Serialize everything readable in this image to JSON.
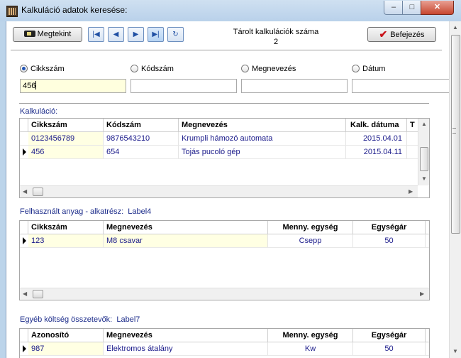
{
  "window": {
    "title": "Kalkuláció adatok keresése:",
    "minimize_glyph": "–",
    "maximize_glyph": "□",
    "close_glyph": "✕"
  },
  "toolbar": {
    "view_button": "Megtekint",
    "view_icon": "keyboard-icon",
    "nav_first": "|◀",
    "nav_prev": "◀",
    "nav_next": "▶",
    "nav_last": "▶|",
    "nav_refresh": "↻",
    "counter_label": "Tárolt kalkulációk száma",
    "counter_value": "2",
    "finish_button": "Befejezés",
    "finish_icon_glyph": "✔"
  },
  "search": {
    "options": [
      {
        "label": "Cikkszám",
        "selected": true
      },
      {
        "label": "Kódszám",
        "selected": false
      },
      {
        "label": "Megnevezés",
        "selected": false
      },
      {
        "label": "Dátum",
        "selected": false
      }
    ],
    "fields": [
      "456",
      "",
      "",
      ""
    ]
  },
  "calc": {
    "label": "Kalkuláció:",
    "headers": [
      "Cikkszám",
      "Kódszám",
      "Megnevezés",
      "Kalk. dátuma",
      "T"
    ],
    "rows": [
      {
        "cikkszam": "0123456789",
        "kodszam": "9876543210",
        "megnevezes": "Krumpli hámozó automata",
        "datum": "2015.04.01"
      },
      {
        "cikkszam": "456",
        "kodszam": "654",
        "megnevezes": "Tojás pucoló gép",
        "datum": "2015.04.11"
      }
    ]
  },
  "material": {
    "label": "Felhasznált anyag - alkatrész:",
    "sub_label": "Label4",
    "headers": [
      "Cikkszám",
      "Megnevezés",
      "Menny. egység",
      "Egységár"
    ],
    "rows": [
      {
        "cikkszam": "123",
        "megnevezes": "M8 csavar",
        "egyseg": "Csepp",
        "ar": "50"
      }
    ]
  },
  "costs": {
    "label": "Egyéb költség összetevők:",
    "sub_label": "Label7",
    "headers": [
      "Azonosító",
      "Megnevezés",
      "Menny. egység",
      "Egységár"
    ],
    "rows": [
      {
        "azonosito": "987",
        "megnevezes": "Elektromos átalány",
        "egyseg": "Kw",
        "ar": "50"
      }
    ]
  },
  "scroll": {
    "left": "◀",
    "right": "▶",
    "up": "▲",
    "down": "▼"
  }
}
